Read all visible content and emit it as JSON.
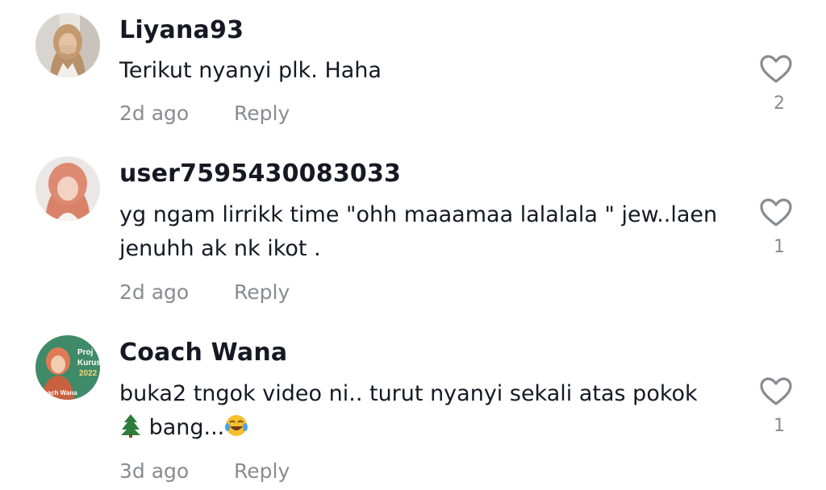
{
  "comments": [
    {
      "username": "Liyana93",
      "text": "Terikut nyanyi plk. Haha",
      "time": "2d ago",
      "reply_label": "Reply",
      "like_count": "2"
    },
    {
      "username": "user7595430083033",
      "text": "yg ngam lirrikk time \"ohh maaamaa lalalala \" jew..laen jenuhh ak nk ikot .",
      "time": "2d ago",
      "reply_label": "Reply",
      "like_count": "1"
    },
    {
      "username": "Coach Wana",
      "text_before": "buka2 tngok video ni.. turut nyanyi sekali atas pokok",
      "text_mid": " bang...",
      "time": "3d ago",
      "reply_label": "Reply",
      "like_count": "1",
      "avatar_text_1": "Proj",
      "avatar_text_2": "Kurus",
      "avatar_text_3": "2022",
      "avatar_text_4": "Coach Wana"
    }
  ],
  "icons": {
    "like": "heart-outline-icon",
    "tree_emoji": "evergreen-tree-emoji",
    "laugh_emoji": "tears-of-joy-emoji"
  },
  "colors": {
    "text": "#161823",
    "muted": "#8a8b91",
    "background": "#ffffff"
  }
}
